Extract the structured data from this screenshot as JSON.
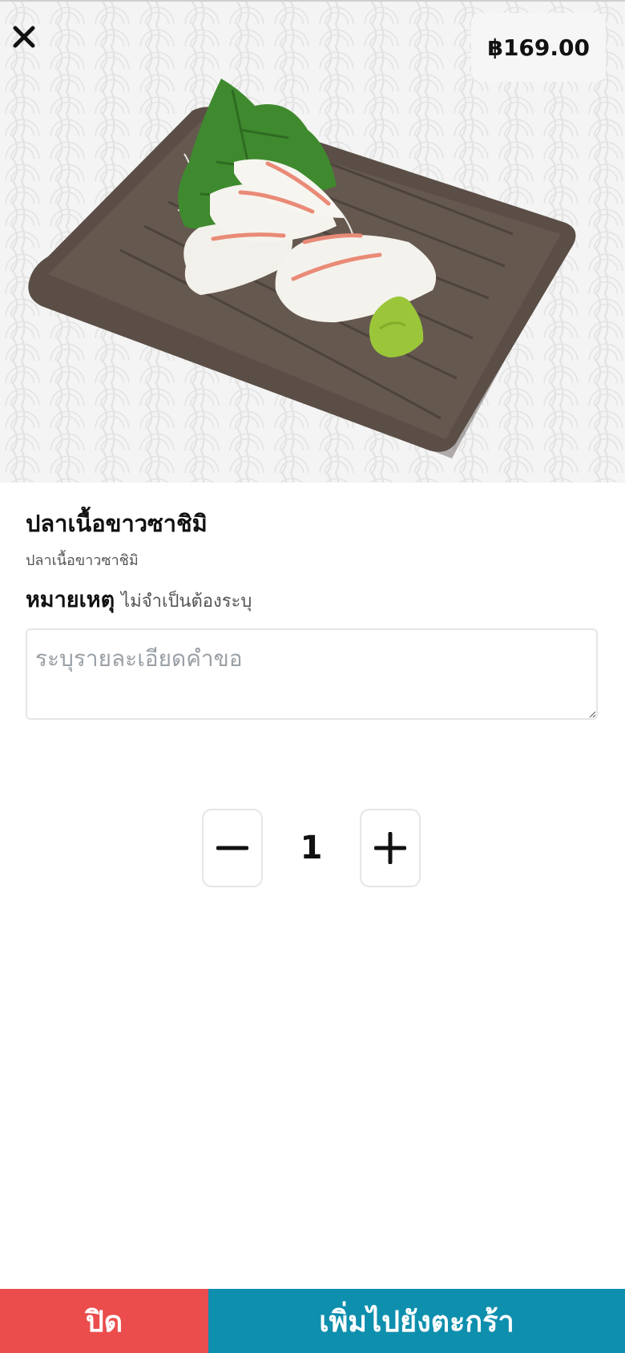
{
  "product": {
    "price": "฿169.00",
    "name": "ปลาเนื้อขาวซาชิมิ",
    "description": "ปลาเนื้อขาวซาชิมิ",
    "image_icon": "sashimi-plate-image"
  },
  "note": {
    "label": "หมายเหตุ",
    "optional_hint": "ไม่จำเป็นต้องระบุ",
    "placeholder": "ระบุรายละเอียดคำขอ",
    "value": ""
  },
  "quantity": {
    "value": "1"
  },
  "actions": {
    "close_label": "ปิด",
    "add_to_cart_label": "เพิ่มไปยังตะกร้า"
  },
  "colors": {
    "close_button": "#eb4d4d",
    "add_button": "#0f8fae"
  }
}
